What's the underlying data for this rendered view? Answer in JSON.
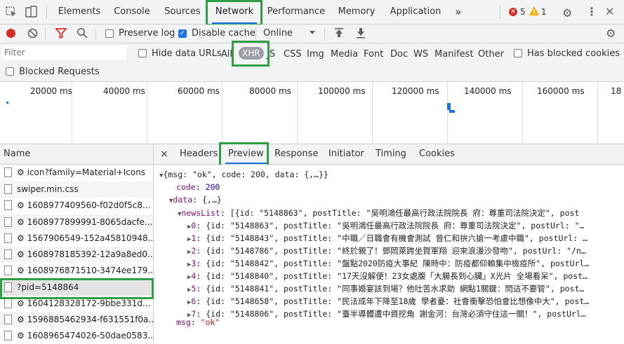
{
  "tabs": [
    "Elements",
    "Console",
    "Sources",
    "Network",
    "Performance",
    "Memory",
    "Application"
  ],
  "tabs_more": "»",
  "errors_count": "5",
  "warnings_count": "1",
  "toolbar": {
    "preserve_log": "Preserve log",
    "disable_cache": "Disable cache",
    "throttle": "Online"
  },
  "filter": {
    "placeholder": "Filter",
    "hide_data_urls": "Hide data URLs",
    "types": [
      "All",
      "XHR",
      "JS",
      "CSS",
      "Img",
      "Media",
      "Font",
      "Doc",
      "WS",
      "Manifest",
      "Other"
    ],
    "has_blocked_cookies": "Has blocked cookies",
    "blocked_requests": "Blocked Requests"
  },
  "timeline_ticks": [
    "20000 ms",
    "40000 ms",
    "60000 ms",
    "80000 ms",
    "100000 ms",
    "120000 ms",
    "140000 ms",
    "160000 ms",
    "18"
  ],
  "name_header": "Name",
  "requests": [
    "icon?family=Material+Icons",
    "swiper.min.css",
    "1608977409560-f02d0f5c8...",
    "1608977899991-8065dacfe...",
    "1567906549-152a45810948...",
    "1608978185392-12a9a8ed0...",
    "1608976871510-3474ee179...",
    "?pid=5148864",
    "1604128328172-9bbe331d...",
    "1596885462934-f631551f0a...",
    "1608965474026-50dae0583..."
  ],
  "detail_tabs": [
    "Headers",
    "Preview",
    "Response",
    "Initiator",
    "Timing",
    "Cookies"
  ],
  "detail_close": "×",
  "preview": {
    "root": "{msg: \"ok\", code: 200, data: {,…}}",
    "code_key": "code",
    "code_val": "200",
    "data_key": "data",
    "data_val": "{,…}",
    "newslist_key": "newsList",
    "newslist_val": "[{id: \"5148863\", postTitle: \"吳明鴻任最高行政法院院長  府：尊重司法院決定\", post",
    "items": [
      {
        "idx": "0",
        "text": "{id: \"5148863\", postTitle: \"吳明鴻任最高行政法院院長  府：尊重司法院決定\", postUrl: \"…"
      },
      {
        "idx": "1",
        "text": "{id: \"5148843\", postTitle: \"中職／日職會有機會測試  曾仁和拚六搶一考慮中職\", postUrl: …"
      },
      {
        "idx": "2",
        "text": "{id: \"5148786\", postTitle: \"終於親了！鄧岡萊跨坐賀軍翔  迎來浪漫沙發吻\", postUrl: \"/n…"
      },
      {
        "idx": "3",
        "text": "{id: \"5148842\", postTitle: \"盤點2020防疫大事紀  陳時中：防疫都仰賴集中檢疫所\", postUrl…"
      },
      {
        "idx": "4",
        "text": "{id: \"5148840\", postTitle: \"17天沒解便！23女處腹「大腸長到心臟」X光片  全場看呆\", post…"
      },
      {
        "idx": "5",
        "text": "{id: \"5148841\", postTitle: \"同事婚宴該到場？他吐苦水求助  網點1關鍵：問這不要管\", post…"
      },
      {
        "idx": "6",
        "text": "{id: \"5148658\", postTitle: \"民法成年下降至18歲  學者憂：社會衝擊恐怕會比想像中大\", post…"
      },
      {
        "idx": "7",
        "text": "{id: \"5148806\", postTitle: \"臺半導體遭中資挖角  謝金河：台灣必須守住這一關！\", postUrl…"
      }
    ],
    "msg_key": "msg",
    "msg_val": "\"ok\""
  },
  "colors": {
    "accent": "#1a73e8",
    "highlight": "#2ea043",
    "record": "#d93025",
    "filter_red": "#d93025"
  }
}
